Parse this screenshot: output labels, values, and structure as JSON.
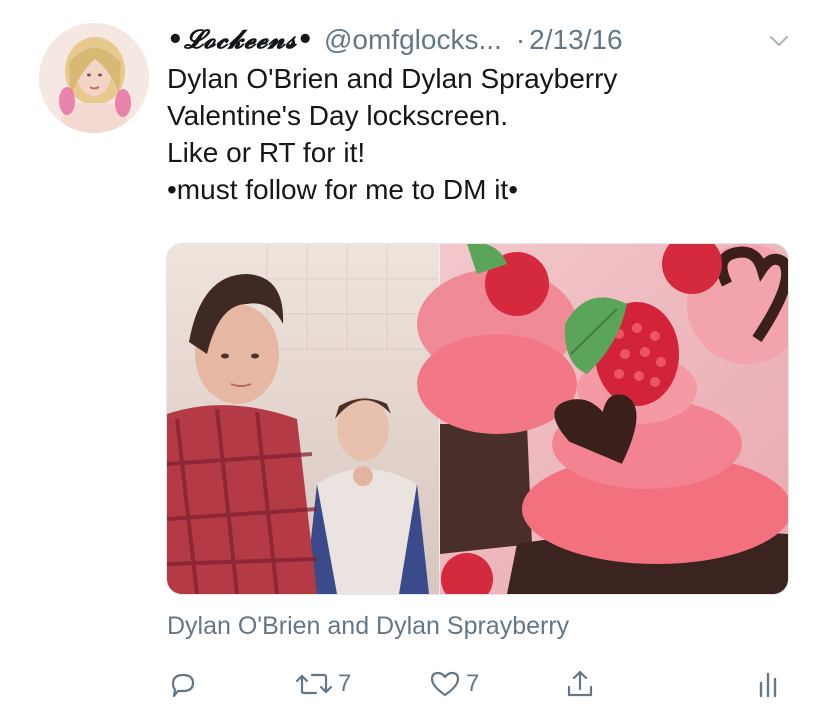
{
  "tweet": {
    "display_name": "•𝓛𝓸𝓬𝓴𝓮𝓮𝓷𝓼•",
    "handle": "@omfglocks...",
    "separator": "·",
    "date": "2/13/16",
    "lines": [
      "Dylan O'Brien and Dylan Sprayberry",
      "Valentine's Day lockscreen.",
      "Like or RT for it!",
      "•must follow for me to DM it•"
    ],
    "media_caption": "Dylan O'Brien and Dylan Sprayberry"
  },
  "actions": {
    "retweet_count": "7",
    "like_count": "7"
  },
  "colors": {
    "text": "#14171a",
    "secondary": "#657786",
    "frosting": "#f06a7a",
    "raspberry": "#e0283b"
  },
  "icons": [
    "reply-icon",
    "retweet-icon",
    "like-icon",
    "share-icon",
    "analytics-icon",
    "chevron-down-icon"
  ]
}
